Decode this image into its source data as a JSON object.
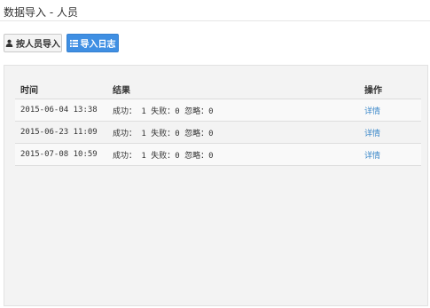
{
  "page": {
    "title": "数据导入 - 人员"
  },
  "toolbar": {
    "person_import_label": "按人员导入",
    "person_import_icon": "user-icon",
    "import_log_label": "导入日志",
    "import_log_icon": "list-icon",
    "active_color": "#3f8fe3"
  },
  "log_table": {
    "headers": {
      "time": "时间",
      "result": "结果",
      "action": "操作"
    },
    "rows": [
      {
        "time": "2015-06-04 13:38",
        "result": "成功： 1 失败：0 忽略：0",
        "action": "详情"
      },
      {
        "time": "2015-06-23 11:09",
        "result": "成功： 1 失败：0 忽略：0",
        "action": "详情"
      },
      {
        "time": "2015-07-08 10:59",
        "result": "成功： 1 失败：0 忽略：0",
        "action": "详情"
      }
    ]
  }
}
